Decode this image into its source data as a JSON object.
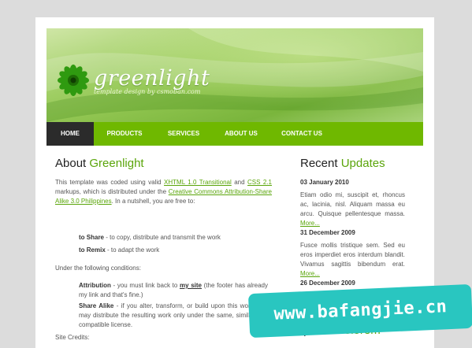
{
  "header": {
    "logo_text": "greenlight",
    "tagline": "template design by csmoban.com",
    "icon": "green-flower-logo-icon"
  },
  "nav": {
    "items": [
      {
        "label": "HOME",
        "active": true
      },
      {
        "label": "PRODUCTS",
        "active": false
      },
      {
        "label": "SERVICES",
        "active": false
      },
      {
        "label": "ABOUT US",
        "active": false
      },
      {
        "label": "CONTACT US",
        "active": false
      }
    ]
  },
  "main": {
    "title_plain": "About ",
    "title_highlight": "Greenlight",
    "intro": {
      "t1": "This template was coded using valid ",
      "l1": "XHTML 1.0 Transitional",
      "t2": " and ",
      "l2": "CSS 2.1",
      "t3": " markups, which is distributed under the ",
      "l3": "Creative Commons Attribution-Share Alike 3.0 Philippines",
      "t4": ". In a nutshell, you are free to:"
    },
    "rights": [
      {
        "term": "to Share",
        "desc": " - to copy, distribute and transmit the work"
      },
      {
        "term": "to Remix",
        "desc": " - to adapt the work"
      }
    ],
    "conditions_intro": "Under the following conditions:",
    "attribution": {
      "term": "Attribution",
      "t1": " - you must link back to ",
      "link": "my site",
      "t2": " (the footer has already my link and that's fine.)"
    },
    "share_alike": {
      "term": "Share Alike",
      "desc": " - if you alter, transform, or build upon this work, you may distribute the resulting work only under the same, similar or a compatible license."
    },
    "credits": "Site Credits:"
  },
  "sidebar": {
    "title_plain": "Recent ",
    "title_highlight": "Updates",
    "updates": [
      {
        "date": "03 January 2010",
        "text": "Etiam odio mi, suscipit et, rhoncus ac, lacinia, nisl. Aliquam massa eu arcu. Quisque pellentesque massa. ",
        "more": "More..."
      },
      {
        "date": "31 December 2009",
        "text": "Fusce mollis tristique sem. Sed eu eros imperdiet eros interdum blandit. Vivamus sagittis bibendum erat. ",
        "more": "More..."
      },
      {
        "date": "26 December 2009",
        "text": "",
        "more": ""
      }
    ],
    "next_title_plain": "Ipsum ",
    "next_title_highlight": "Dolorem"
  },
  "watermark": "www.bafangjie.cn",
  "colors": {
    "accent_green": "#5aa50a",
    "nav_green": "#6fb800",
    "nav_active": "#2b2b2b",
    "watermark_bg": "#29c6c0"
  }
}
